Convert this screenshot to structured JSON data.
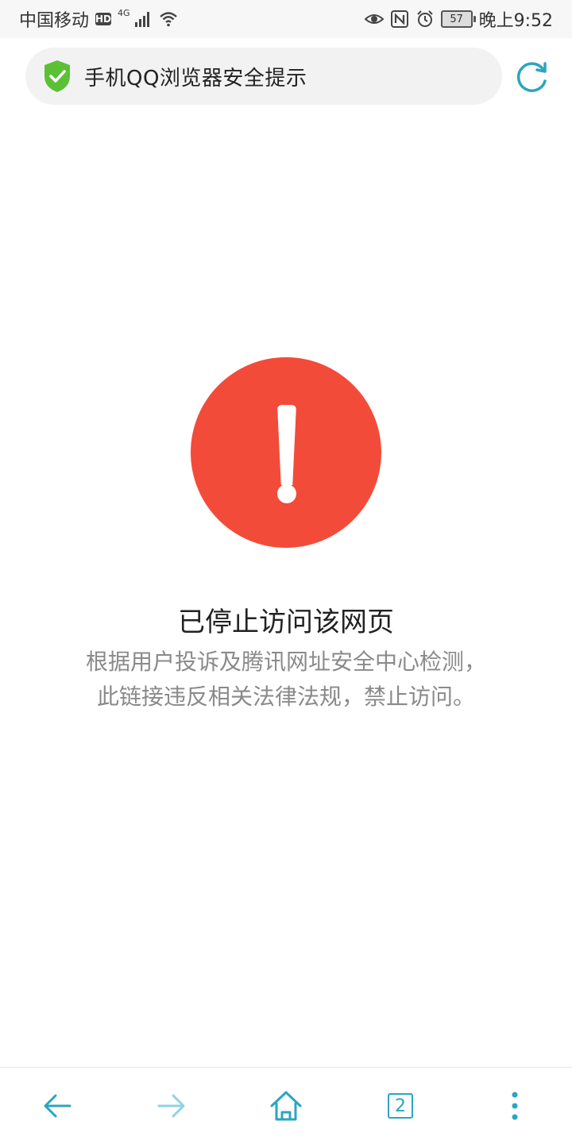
{
  "status_bar": {
    "carrier": "中国移动",
    "hd_badge": "HD",
    "network": "4G",
    "battery": "57",
    "time": "晚上9:52",
    "icons": [
      "signal-icon",
      "wifi-icon",
      "eye-icon",
      "nfc-icon",
      "alarm-icon",
      "battery-icon"
    ]
  },
  "address_bar": {
    "text": "手机QQ浏览器安全提示",
    "icon": "shield-check-icon"
  },
  "warning": {
    "icon": "exclamation-icon",
    "title": "已停止访问该网页",
    "line1": "根据用户投诉及腾讯网址安全中心检测，",
    "line2": "此链接违反相关法律法规，禁止访问。"
  },
  "bottom_bar": {
    "tab_count": "2",
    "icons": [
      "back-arrow-icon",
      "forward-arrow-icon",
      "home-icon",
      "tabs-icon",
      "more-menu-icon"
    ]
  },
  "colors": {
    "accent": "#2aa6c0",
    "danger": "#f34b3a",
    "shield": "#5cc036"
  }
}
